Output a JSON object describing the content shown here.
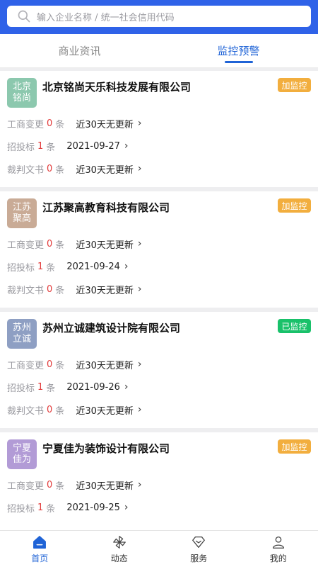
{
  "search": {
    "placeholder": "输入企业名称 / 统一社会信用代码"
  },
  "tabs": [
    {
      "label": "商业资讯",
      "active": false
    },
    {
      "label": "监控预警",
      "active": true
    }
  ],
  "companies": [
    {
      "logo_text": "北京铭尚",
      "logo_color": "#8cc8ae",
      "name": "北京铭尚天乐科技发展有限公司",
      "badge": "加监控",
      "badge_color": "#f2ae3e",
      "rows": [
        {
          "label": "工商变更",
          "count": "0",
          "unit": "条",
          "info": "近30天无更新"
        },
        {
          "label": "招投标",
          "count": "1",
          "unit": "条",
          "info": "2021-09-27"
        },
        {
          "label": "裁判文书",
          "count": "0",
          "unit": "条",
          "info": "近30天无更新"
        }
      ]
    },
    {
      "logo_text": "江苏聚高",
      "logo_color": "#c9ab96",
      "name": "江苏聚高教育科技有限公司",
      "badge": "加监控",
      "badge_color": "#f2ae3e",
      "rows": [
        {
          "label": "工商变更",
          "count": "0",
          "unit": "条",
          "info": "近30天无更新"
        },
        {
          "label": "招投标",
          "count": "1",
          "unit": "条",
          "info": "2021-09-24"
        },
        {
          "label": "裁判文书",
          "count": "0",
          "unit": "条",
          "info": "近30天无更新"
        }
      ]
    },
    {
      "logo_text": "苏州立诚",
      "logo_color": "#8e9fc3",
      "name": "苏州立诚建筑设计院有限公司",
      "badge": "已监控",
      "badge_color": "#19c16a",
      "rows": [
        {
          "label": "工商变更",
          "count": "0",
          "unit": "条",
          "info": "近30天无更新"
        },
        {
          "label": "招投标",
          "count": "1",
          "unit": "条",
          "info": "2021-09-26"
        },
        {
          "label": "裁判文书",
          "count": "0",
          "unit": "条",
          "info": "近30天无更新"
        }
      ]
    },
    {
      "logo_text": "宁夏佳为",
      "logo_color": "#b29bd6",
      "name": "宁夏佳为装饰设计有限公司",
      "badge": "加监控",
      "badge_color": "#f2ae3e",
      "rows": [
        {
          "label": "工商变更",
          "count": "0",
          "unit": "条",
          "info": "近30天无更新"
        },
        {
          "label": "招投标",
          "count": "1",
          "unit": "条",
          "info": "2021-09-25"
        }
      ]
    }
  ],
  "bottom_nav": [
    {
      "label": "首页",
      "icon": "home-icon",
      "active": true
    },
    {
      "label": "动态",
      "icon": "pinwheel-icon",
      "active": false
    },
    {
      "label": "服务",
      "icon": "diamond-icon",
      "active": false
    },
    {
      "label": "我的",
      "icon": "user-icon",
      "active": false
    }
  ],
  "colors": {
    "primary": "#2f62e8",
    "accent": "#1f63d6",
    "count": "#e23b3b"
  }
}
